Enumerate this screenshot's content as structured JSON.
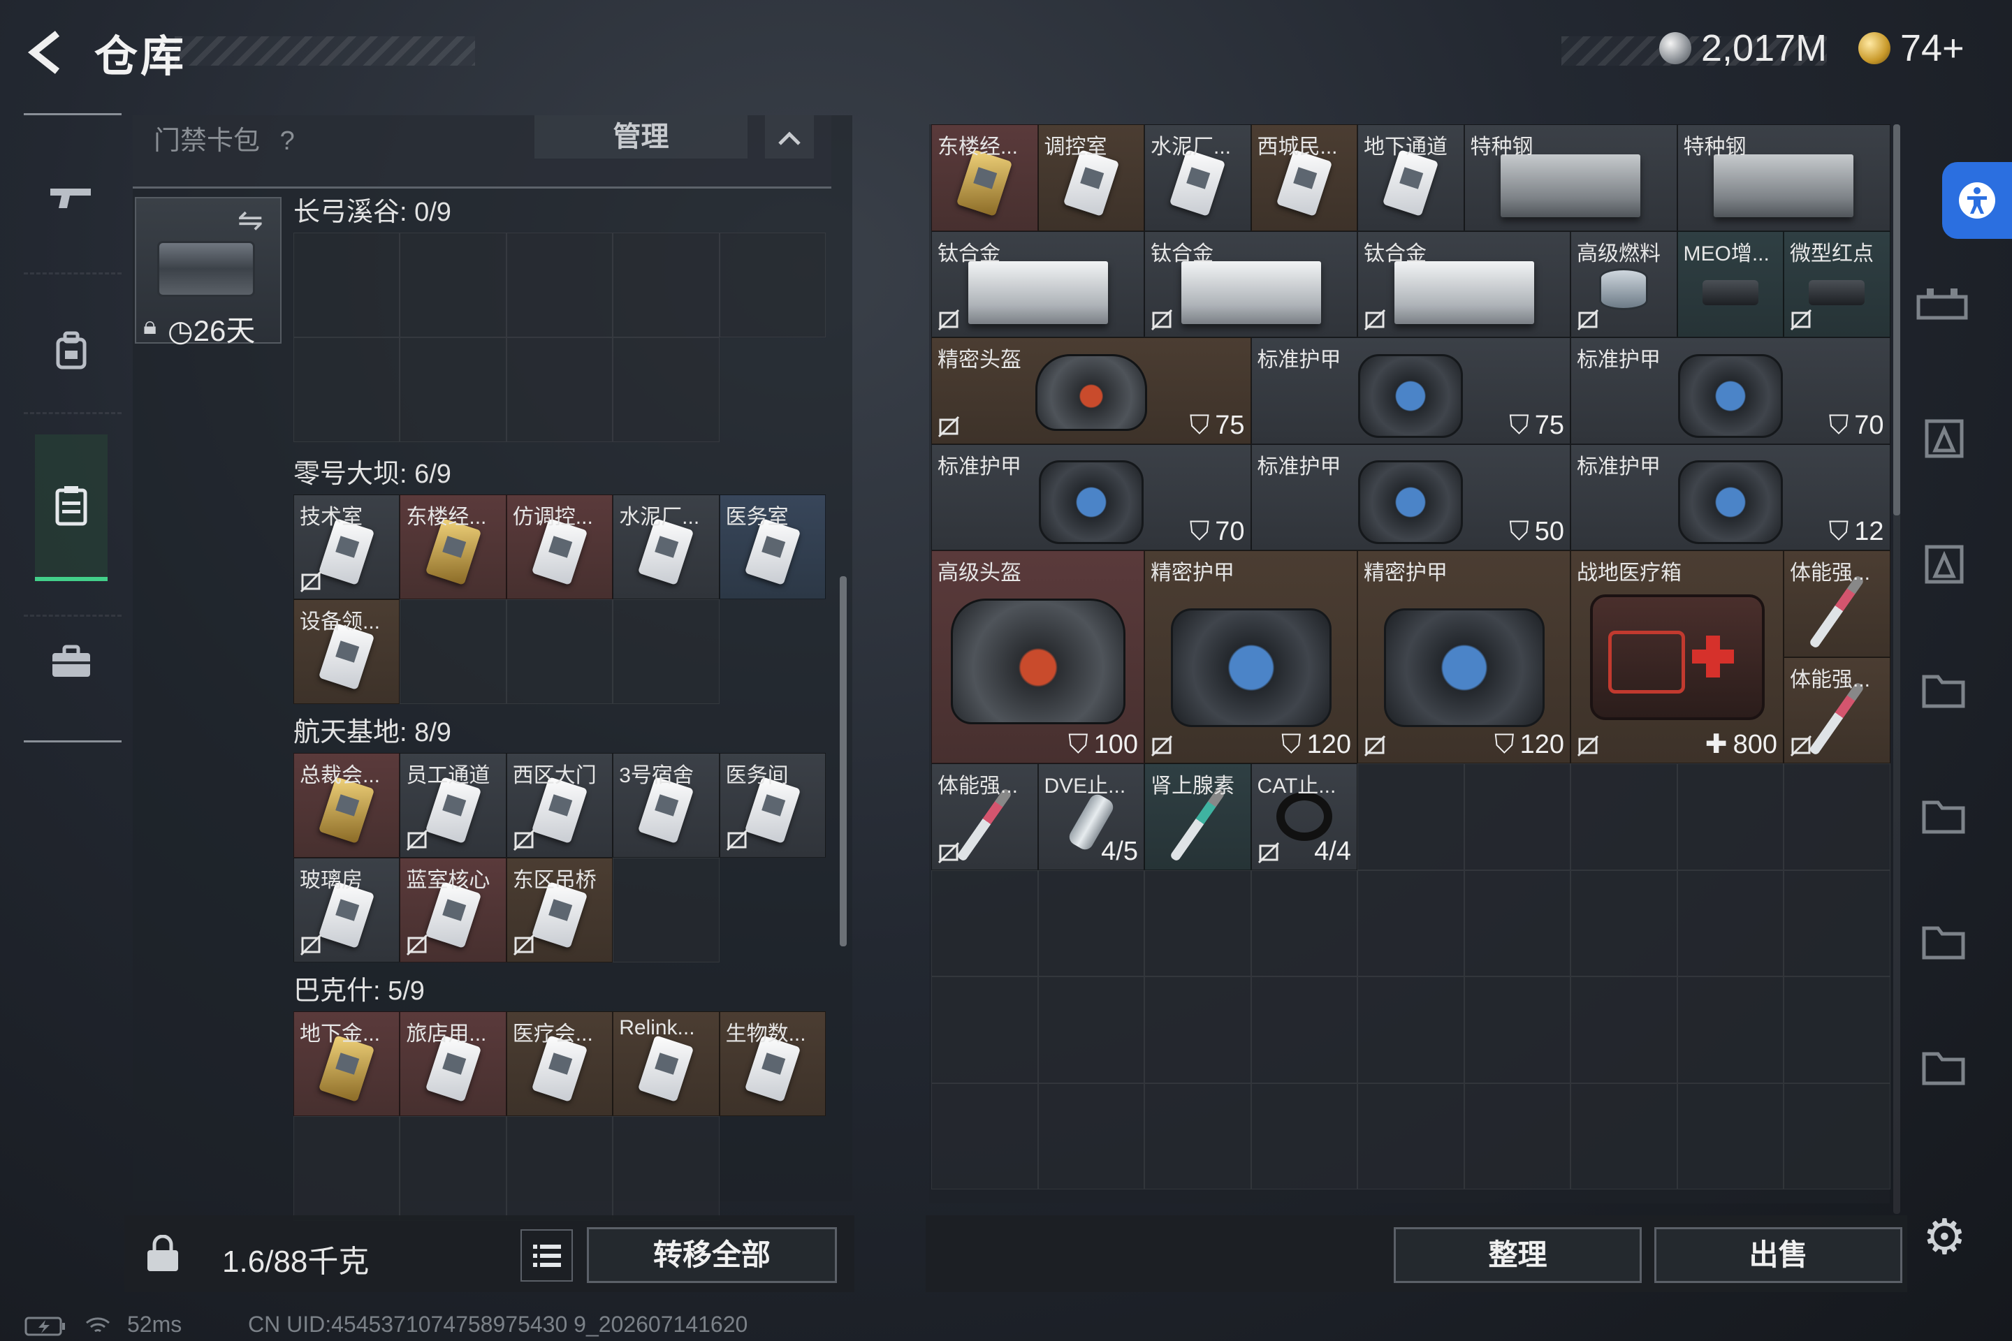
{
  "header": {
    "title": "仓库",
    "currency_primary": "2,017M",
    "currency_secondary": "74+"
  },
  "sidebar": {
    "items": [
      {
        "icon": "gun-icon"
      },
      {
        "icon": "backpack-icon"
      },
      {
        "icon": "storage-icon",
        "active": true
      },
      {
        "icon": "briefcase-icon"
      }
    ]
  },
  "left": {
    "cardpack_label": "门禁卡包",
    "cardpack_help": "?",
    "manage_label": "管理",
    "collapse_label": "^",
    "bag_timer": "26天",
    "sections": [
      {
        "title": "长弓溪谷: 0/9",
        "items": []
      },
      {
        "title": "零号大坝: 6/9",
        "items": [
          {
            "name": "技术室",
            "c": "gray",
            "nosell": true
          },
          {
            "name": "东楼经...",
            "c": "red",
            "gold": true
          },
          {
            "name": "仿调控...",
            "c": "red"
          },
          {
            "name": "水泥厂...",
            "c": "gray"
          },
          {
            "name": "医务室",
            "c": "blue"
          },
          {
            "name": "设备领...",
            "c": "brown"
          }
        ]
      },
      {
        "title": "航天基地: 8/9",
        "items": [
          {
            "name": "总裁会...",
            "c": "red",
            "gold": true
          },
          {
            "name": "员工通道",
            "c": "gray",
            "nosell": true
          },
          {
            "name": "西区大门",
            "c": "gray",
            "nosell": true
          },
          {
            "name": "3号宿舍",
            "c": "gray"
          },
          {
            "name": "医务间",
            "c": "gray",
            "nosell": true
          },
          {
            "name": "玻璃房",
            "c": "gray",
            "nosell": true
          },
          {
            "name": "蓝室核心",
            "c": "red",
            "nosell": true
          },
          {
            "name": "东区吊桥",
            "c": "brown",
            "nosell": true
          }
        ]
      },
      {
        "title": "巴克什: 5/9",
        "items": [
          {
            "name": "地下金...",
            "c": "red",
            "gold": true
          },
          {
            "name": "旅店用...",
            "c": "red"
          },
          {
            "name": "医疗会...",
            "c": "brown"
          },
          {
            "name": "Relink...",
            "c": "brown"
          },
          {
            "name": "生物数...",
            "c": "brown"
          }
        ]
      }
    ],
    "weight": "1.6/88千克",
    "transfer_all": "转移全部"
  },
  "stash": {
    "items": [
      {
        "name": "东楼经...",
        "col": 0,
        "row": 0,
        "w": 1,
        "h": 1,
        "c": "red",
        "art": "keycard-gold"
      },
      {
        "name": "调控室",
        "col": 1,
        "row": 0,
        "w": 1,
        "h": 1,
        "c": "brown",
        "art": "keycard"
      },
      {
        "name": "水泥厂...",
        "col": 2,
        "row": 0,
        "w": 1,
        "h": 1,
        "c": "gray",
        "art": "keycard"
      },
      {
        "name": "西城民...",
        "col": 3,
        "row": 0,
        "w": 1,
        "h": 1,
        "c": "brown",
        "art": "keycard"
      },
      {
        "name": "地下通道",
        "col": 4,
        "row": 0,
        "w": 1,
        "h": 1,
        "c": "gray",
        "art": "keycard"
      },
      {
        "name": "特种钢",
        "col": 5,
        "row": 0,
        "w": 2,
        "h": 1,
        "c": "gray",
        "art": "darkmetal"
      },
      {
        "name": "特种钢",
        "col": 7,
        "row": 0,
        "w": 2,
        "h": 1,
        "c": "gray",
        "art": "darkmetal"
      },
      {
        "name": "钛合金",
        "col": 0,
        "row": 1,
        "w": 2,
        "h": 1,
        "c": "gray",
        "art": "metal",
        "nosell": true
      },
      {
        "name": "钛合金",
        "col": 2,
        "row": 1,
        "w": 2,
        "h": 1,
        "c": "gray",
        "art": "metal",
        "nosell": true
      },
      {
        "name": "钛合金",
        "col": 4,
        "row": 1,
        "w": 2,
        "h": 1,
        "c": "gray",
        "art": "metal",
        "nosell": true
      },
      {
        "name": "高级燃料",
        "col": 6,
        "row": 1,
        "w": 1,
        "h": 1,
        "c": "gray",
        "art": "can",
        "nosell": true
      },
      {
        "name": "MEO增...",
        "col": 7,
        "row": 1,
        "w": 1,
        "h": 1,
        "c": "teal",
        "art": "scope"
      },
      {
        "name": "微型红点",
        "col": 8,
        "row": 1,
        "w": 1,
        "h": 1,
        "c": "teal",
        "art": "scope",
        "nosell": true
      },
      {
        "name": "精密头盔",
        "col": 0,
        "row": 2,
        "w": 3,
        "h": 1,
        "c": "brown",
        "art": "helmet",
        "num": "75",
        "shield": true,
        "nosell": true
      },
      {
        "name": "标准护甲",
        "col": 3,
        "row": 2,
        "w": 3,
        "h": 1,
        "c": "gray",
        "art": "armor",
        "num": "75",
        "shield": true
      },
      {
        "name": "标准护甲",
        "col": 6,
        "row": 2,
        "w": 3,
        "h": 1,
        "c": "gray",
        "art": "armor",
        "num": "70",
        "shield": true
      },
      {
        "name": "标准护甲",
        "col": 0,
        "row": 3,
        "w": 3,
        "h": 1,
        "c": "gray",
        "art": "armor",
        "num": "70",
        "shield": true
      },
      {
        "name": "标准护甲",
        "col": 3,
        "row": 3,
        "w": 3,
        "h": 1,
        "c": "gray",
        "art": "armor",
        "num": "50",
        "shield": true
      },
      {
        "name": "标准护甲",
        "col": 6,
        "row": 3,
        "w": 3,
        "h": 1,
        "c": "gray",
        "art": "armor",
        "num": "12",
        "shield": true
      },
      {
        "name": "高级头盔",
        "col": 0,
        "row": 4,
        "w": 2,
        "h": 2,
        "c": "red",
        "art": "helmet-big",
        "num": "100",
        "shield": true
      },
      {
        "name": "精密护甲",
        "col": 2,
        "row": 4,
        "w": 2,
        "h": 2,
        "c": "brown",
        "art": "armor-big",
        "num": "120",
        "shield": true,
        "nosell": true
      },
      {
        "name": "精密护甲",
        "col": 4,
        "row": 4,
        "w": 2,
        "h": 2,
        "c": "brown",
        "art": "armor-big",
        "num": "120",
        "shield": true,
        "nosell": true
      },
      {
        "name": "战地医疗箱",
        "col": 6,
        "row": 4,
        "w": 2,
        "h": 2,
        "c": "brown",
        "art": "medkit",
        "num": "800",
        "plus": true,
        "nosell": true
      },
      {
        "name": "体能强...",
        "col": 8,
        "row": 4,
        "w": 1,
        "h": 1,
        "c": "brown",
        "art": "syringe"
      },
      {
        "name": "体能强...",
        "col": 8,
        "row": 5,
        "w": 1,
        "h": 1,
        "c": "brown",
        "art": "syringe",
        "nosell": true
      },
      {
        "name": "体能强...",
        "col": 0,
        "row": 6,
        "w": 1,
        "h": 1,
        "c": "gray",
        "art": "syringe",
        "nosell": true
      },
      {
        "name": "DVE止...",
        "col": 1,
        "row": 6,
        "w": 1,
        "h": 1,
        "c": "gray",
        "art": "bottle",
        "num": "4/5"
      },
      {
        "name": "肾上腺素",
        "col": 2,
        "row": 6,
        "w": 1,
        "h": 1,
        "c": "teal",
        "art": "syringe-green"
      },
      {
        "name": "CAT止...",
        "col": 3,
        "row": 6,
        "w": 1,
        "h": 1,
        "c": "gray",
        "art": "tourniquet",
        "num": "4/4",
        "nosell": true
      }
    ],
    "sort_label": "整理",
    "sell_label": "出售"
  },
  "status": {
    "ping": "52ms",
    "uid": "CN UID:4545371074758975430 9_202607141620"
  }
}
